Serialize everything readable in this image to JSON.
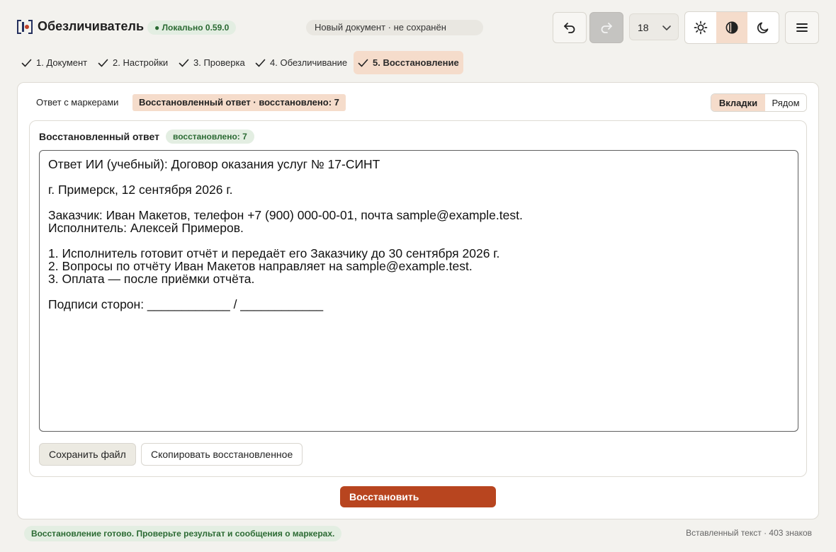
{
  "app": {
    "title": "Обезличиватель",
    "version_badge": "● Локально 0.59.0",
    "doc_status": "Новый документ · не сохранён"
  },
  "toolbar": {
    "undo_icon": "undo-icon",
    "redo_icon": "redo-icon",
    "font_size": "18",
    "themes": [
      "sun-icon",
      "contrast-icon",
      "moon-icon"
    ],
    "active_theme": "contrast-icon",
    "menu_icon": "hamburger-icon"
  },
  "steps": [
    {
      "label": "1. Документ",
      "done": true
    },
    {
      "label": "2. Настройки",
      "done": true
    },
    {
      "label": "3. Проверка",
      "done": true
    },
    {
      "label": "4. Обезличивание",
      "done": true
    },
    {
      "label": "5. Восстановление",
      "done": true,
      "active": true
    }
  ],
  "tabs": {
    "markers": "Ответ с маркерами",
    "restored": "Восстановленный ответ · восстановлено: 7"
  },
  "view_toggle": {
    "tabs": "Вкладки",
    "side": "Рядом"
  },
  "panel": {
    "title": "Восстановленный ответ",
    "badge": "восстановлено: 7",
    "text": "Ответ ИИ (учебный): Договор оказания услуг № 17-СИНТ\n\nг. Примерск, 12 сентября 2026 г.\n\nЗаказчик: Иван Макетов, телефон +7 (900) 000-00-01, почта sample@example.test.\nИсполнитель: Алексей Примеров.\n\n1. Исполнитель готовит отчёт и передаёт его Заказчику до 30 сентября 2026 г.\n2. Вопросы по отчёту Иван Макетов направляет на sample@example.test.\n3. Оплата — после приёмки отчёта.\n\nПодписи сторон: ____________ / ____________",
    "save_label": "Сохранить файл",
    "copy_label": "Скопировать восстановленное"
  },
  "restore_label": "Восстановить",
  "footer": {
    "status": "Восстановление готово. Проверьте результат и сообщения о маркерах.",
    "char_count": "Вставленный текст · 403 знаков"
  },
  "colors": {
    "accent": "#b8451f",
    "accent_soft": "#f5dccb",
    "success_bg": "#e3eee2",
    "success_text": "#2b6a33"
  }
}
